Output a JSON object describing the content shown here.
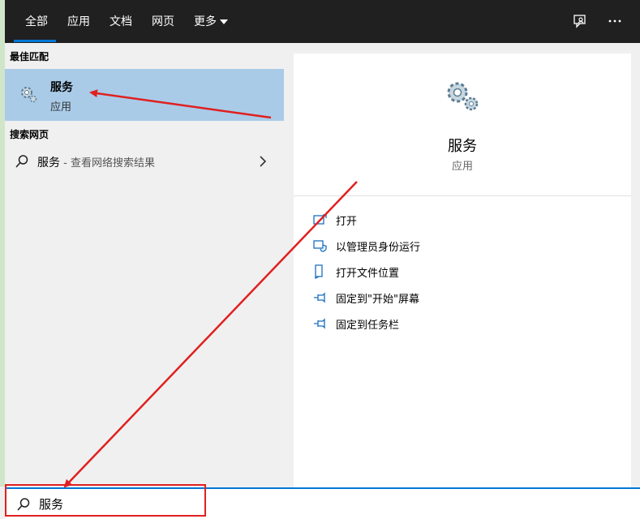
{
  "tabs": [
    {
      "label": "全部",
      "active": true
    },
    {
      "label": "应用"
    },
    {
      "label": "文档"
    },
    {
      "label": "网页"
    },
    {
      "label": "更多"
    }
  ],
  "left": {
    "best_match_title": "最佳匹配",
    "best_match": {
      "title": "服务",
      "subtitle": "应用"
    },
    "web_title": "搜索网页",
    "web_result": {
      "query": "服务",
      "suffix": " - 查看网络搜索结果"
    }
  },
  "right": {
    "app_name": "服务",
    "app_type": "应用",
    "actions": [
      {
        "label": "打开",
        "icon": "open-icon"
      },
      {
        "label": "以管理员身份运行",
        "icon": "shield-icon"
      },
      {
        "label": "打开文件位置",
        "icon": "file-location-icon"
      },
      {
        "label": "固定到\"开始\"屏幕",
        "icon": "pin-icon"
      },
      {
        "label": "固定到任务栏",
        "icon": "pin-icon"
      }
    ]
  },
  "search": {
    "value": "服务"
  },
  "colors": {
    "accent": "#0078d7",
    "highlight": "#a9cbe8",
    "annotation": "#e02020",
    "topbar": "#202020"
  }
}
